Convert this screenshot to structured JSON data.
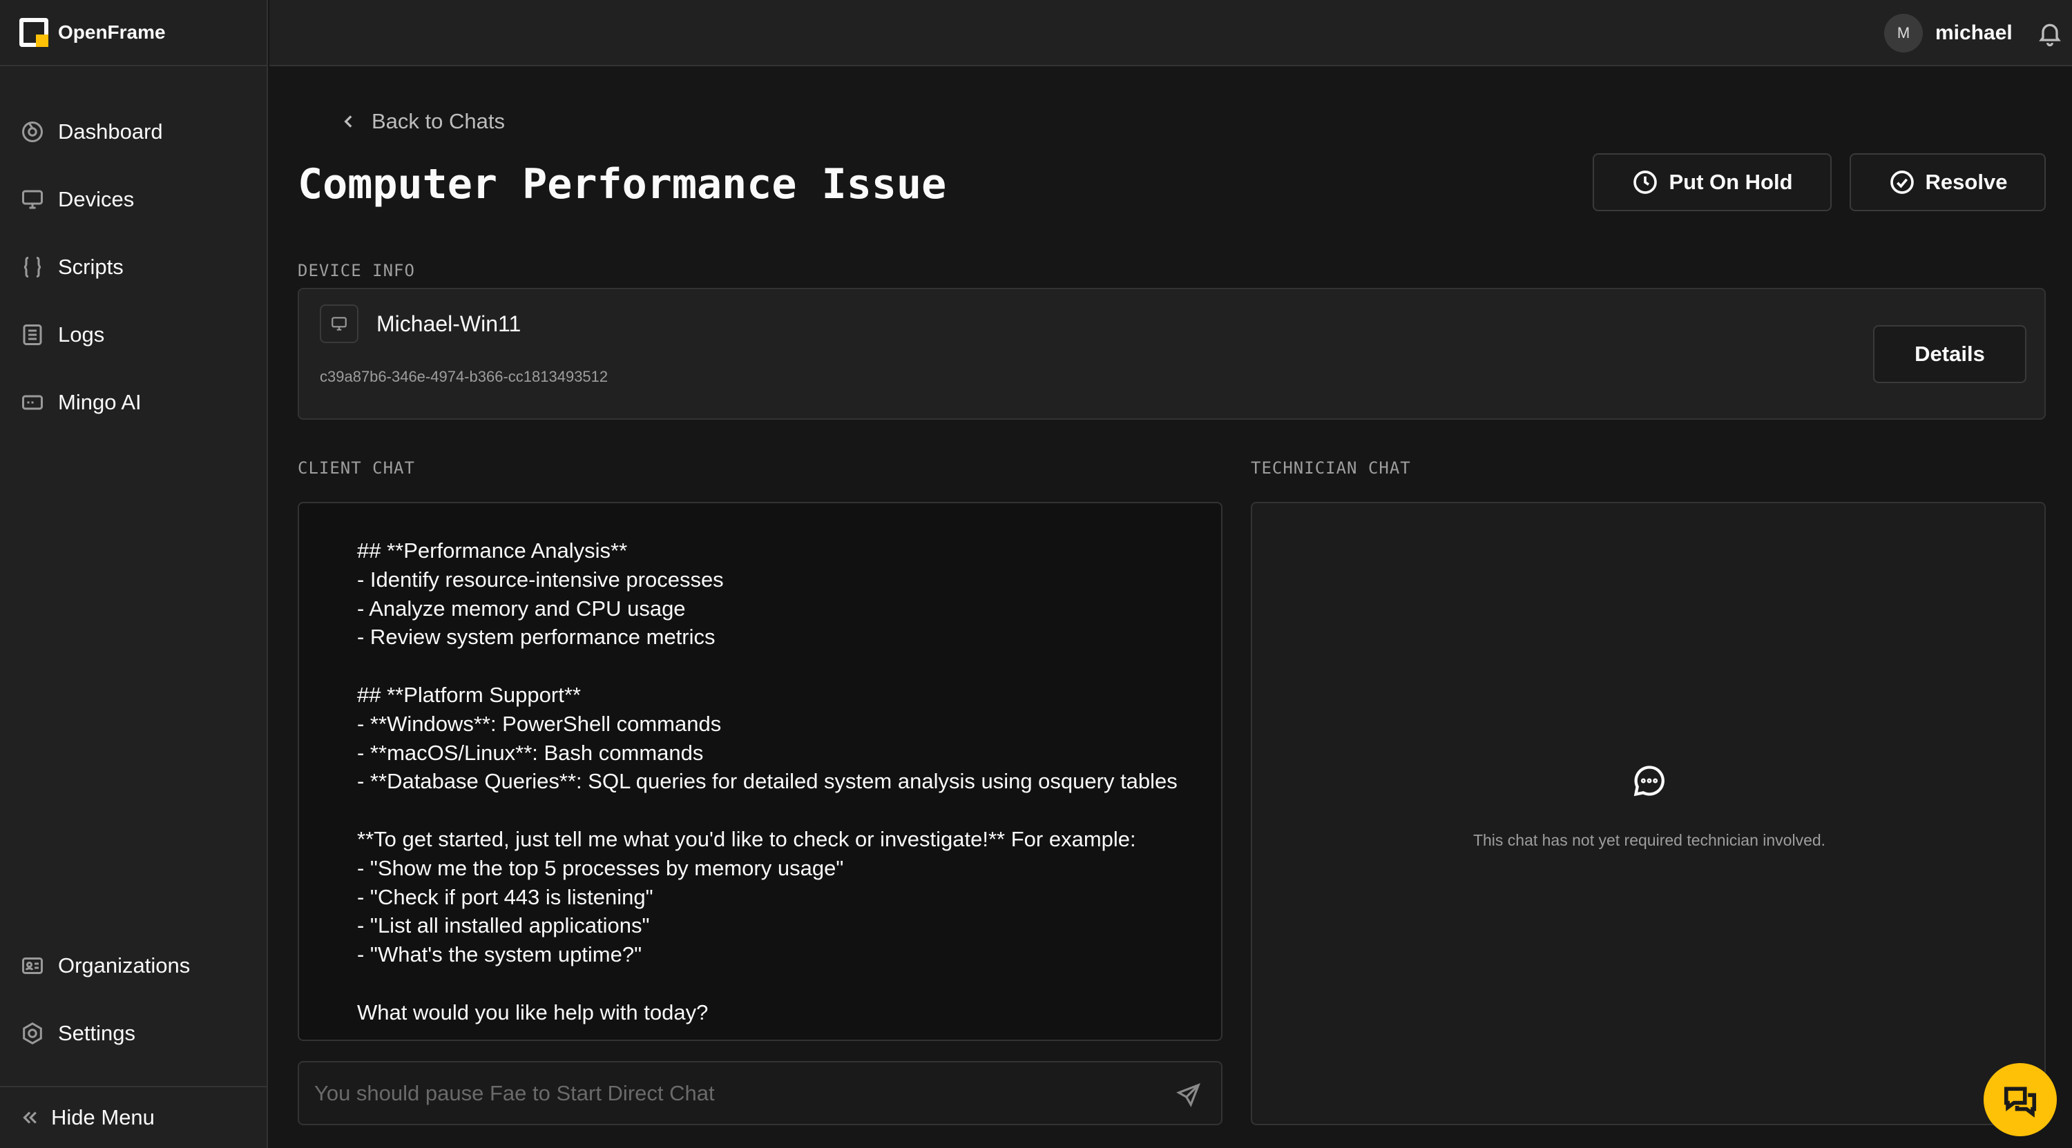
{
  "app": {
    "name": "OpenFrame"
  },
  "sidebar": {
    "items": [
      {
        "label": "Dashboard",
        "icon": "dashboard-icon"
      },
      {
        "label": "Devices",
        "icon": "monitor-icon"
      },
      {
        "label": "Scripts",
        "icon": "braces-icon"
      },
      {
        "label": "Logs",
        "icon": "list-icon"
      },
      {
        "label": "Mingo AI",
        "icon": "ai-chat-icon"
      }
    ],
    "bottom_items": [
      {
        "label": "Organizations",
        "icon": "id-card-icon"
      },
      {
        "label": "Settings",
        "icon": "gear-icon"
      }
    ],
    "hide_menu_label": "Hide Menu"
  },
  "header": {
    "user": {
      "initial": "M",
      "name": "michael"
    }
  },
  "page": {
    "back_label": "Back to Chats",
    "title": "Computer Performance Issue",
    "actions": {
      "hold_label": "Put On Hold",
      "resolve_label": "Resolve"
    }
  },
  "device_info": {
    "section_label": "DEVICE INFO",
    "name": "Michael-Win11",
    "id": "c39a87b6-346e-4974-b366-cc1813493512",
    "details_label": "Details"
  },
  "client_chat": {
    "section_label": "CLIENT CHAT",
    "message": "## **Performance Analysis**\n- Identify resource-intensive processes\n- Analyze memory and CPU usage\n- Review system performance metrics\n\n## **Platform Support**\n- **Windows**: PowerShell commands\n- **macOS/Linux**: Bash commands\n- **Database Queries**: SQL queries for detailed system analysis using osquery tables\n\n**To get started, just tell me what you'd like to check or investigate!** For example:\n- \"Show me the top 5 processes by memory usage\"\n- \"Check if port 443 is listening\"\n- \"List all installed applications\"\n- \"What's the system uptime?\"\n\nWhat would you like help with today?",
    "input_placeholder": "You should pause Fae to Start Direct Chat"
  },
  "technician_chat": {
    "section_label": "TECHNICIAN CHAT",
    "empty_text": "This chat has not yet required technician involved."
  },
  "colors": {
    "accent": "#ffc008",
    "background": "#161616",
    "panel": "#212121"
  }
}
